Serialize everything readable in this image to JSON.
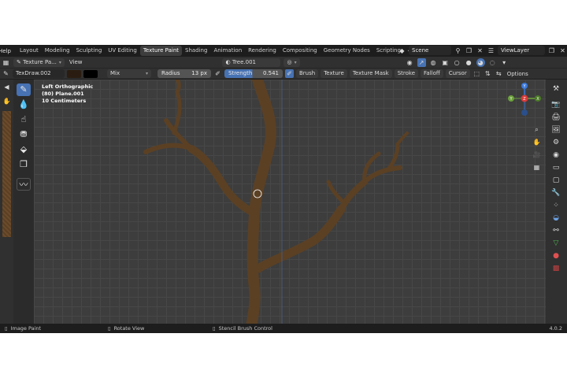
{
  "menu": {
    "help": "Help"
  },
  "workspace_tabs": [
    "Layout",
    "Modeling",
    "Sculpting",
    "UV Editing",
    "Texture Paint",
    "Shading",
    "Animation",
    "Rendering",
    "Compositing",
    "Geometry Nodes",
    "Scripting"
  ],
  "active_tab": "Texture Paint",
  "scene": {
    "name": "Scene"
  },
  "view_layer": {
    "name": "ViewLayer"
  },
  "header1": {
    "texture_slot": "Texture Pa...",
    "view_menu": "View",
    "object": "Tree.001"
  },
  "header2": {
    "brush_name": "TexDraw.002",
    "blend_mode": "Mix",
    "radius_label": "Radius",
    "radius_value": "13 px",
    "strength_label": "Strength",
    "strength_value": "0.541",
    "menus": [
      "Brush",
      "Texture",
      "Texture Mask",
      "Stroke",
      "Falloff",
      "Cursor"
    ],
    "options": "Options"
  },
  "viewport": {
    "view_name": "Left Orthographic",
    "object_info": "(80) Plane.001",
    "scale_info": "10 Centimeters"
  },
  "gizmo": {
    "top": "Y",
    "left": "Y",
    "right": "X",
    "center": "Z"
  },
  "status": {
    "left": "Image Paint",
    "middle": "Rotate View",
    "right": "Stencil Brush Control",
    "version": "4.0.2"
  },
  "colors": {
    "accent": "#4772b3",
    "branch": "#5b4024",
    "viewport_bg": "#3d3d3d",
    "gizmo_x": "#d83a3a",
    "gizmo_y": "#6ba03a",
    "gizmo_z": "#3a78d8"
  }
}
